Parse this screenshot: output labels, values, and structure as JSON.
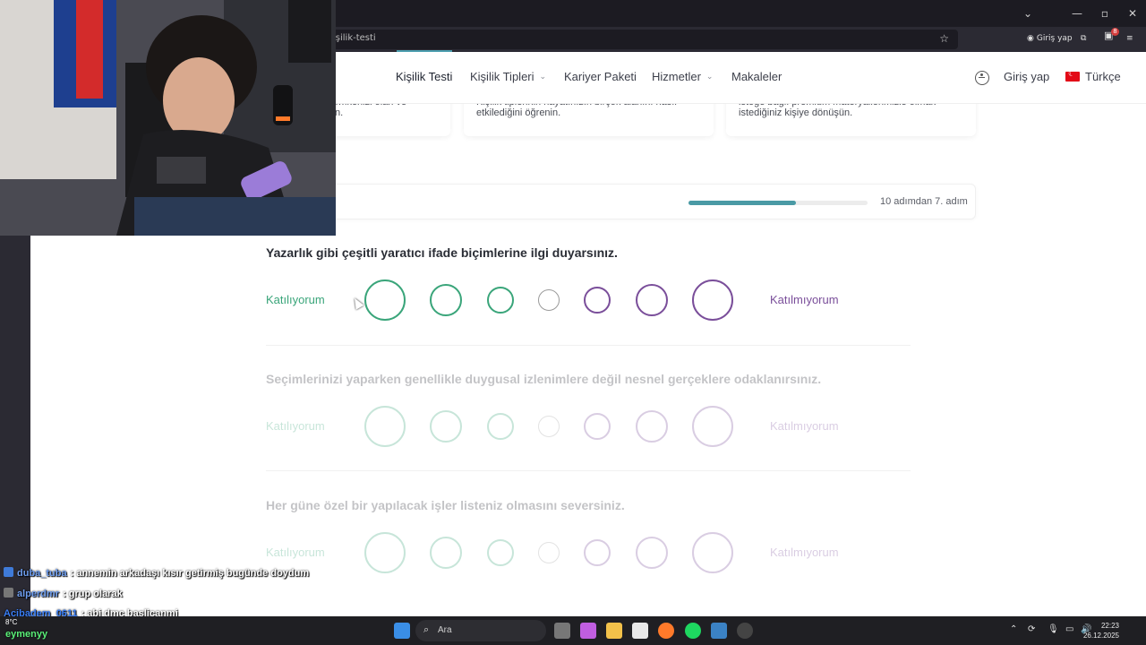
{
  "browser": {
    "url_fragment": "işilik-testi",
    "signin_label": "Giriş yap",
    "ext_badge_count": "8"
  },
  "nav": {
    "items": [
      {
        "label": "Kişilik Testi",
        "has_dropdown": false
      },
      {
        "label": "Kişilik Tipleri",
        "has_dropdown": true
      },
      {
        "label": "Kariyer Paketi",
        "has_dropdown": false
      },
      {
        "label": "Hizmetler",
        "has_dropdown": true
      },
      {
        "label": "Makaleler",
        "has_dropdown": false
      }
    ],
    "login": "Giriş yap",
    "language": "Türkçe"
  },
  "cards": [
    {
      "line1": "…ikenizi olan ve",
      "line2": "n."
    },
    {
      "line1": "Kişilik tiplerinin hayatınızın birçok alanını nasıl",
      "line2": "etkilediğini öğrenin."
    },
    {
      "line1": "isteğe bağlı premium materyallerimizle olmak",
      "line2": "istediğiniz kişiye dönüşün."
    }
  ],
  "progress": {
    "text": "10 adımdan 7. adım",
    "fraction": 0.6
  },
  "questions": [
    {
      "text": "Yazarlık gibi çeşitli yaratıcı ifade biçimlerine ilgi duyarsınız.",
      "agree": "Katılıyorum",
      "disagree": "Katılmıyorum",
      "faded": false
    },
    {
      "text": "Seçimlerinizi yaparken genellikle duygusal izlenimlere değil nesnel gerçeklere odaklanırsınız.",
      "agree": "Katılıyorum",
      "disagree": "Katılmıyorum",
      "faded": true
    },
    {
      "text": "Her güne özel bir yapılacak işler listeniz olmasını seversiniz.",
      "agree": "Katılıyorum",
      "disagree": "Katılmıyorum",
      "faded": true
    }
  ],
  "chat": [
    {
      "user": "duba_tuba",
      "message": ": annemin arkadaşı kısır getirmiş bugünde doydum",
      "user_color": "#6e9ef0"
    },
    {
      "user": "alperdmr",
      "message": ": grup olarak",
      "user_color": "#6e9ef0"
    },
    {
      "user": "Acibadem_0611",
      "message": ": abi dmc baslicanmi",
      "user_color": "#3a7ef5"
    }
  ],
  "taskbar": {
    "search_label": "Ara",
    "time": "22:23",
    "date": "26.12.2025",
    "weather": "8°C",
    "streamer": "eymenyy"
  },
  "colors": {
    "agree": "#3aa57a",
    "disagree": "#7a4e9a",
    "neutral": "#9a9a9a",
    "progress": "#4a9aa5"
  }
}
